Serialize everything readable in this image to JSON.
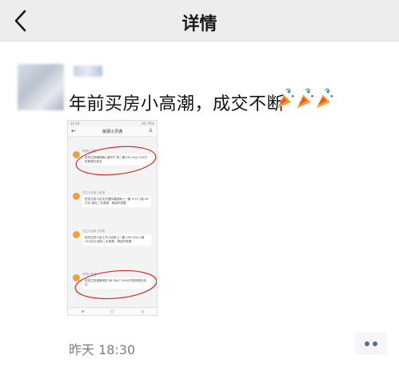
{
  "header": {
    "title": "详情",
    "back_icon": "chevron-left-icon"
  },
  "post": {
    "text": "年前买房小高潮，成交不断",
    "emoji": [
      "party-popper-icon",
      "party-popper-icon",
      "party-popper-icon"
    ],
    "timestamp": "昨天 18:30",
    "more_icon": "more-dots-icon"
  },
  "screenshot": {
    "status_time": "12:16",
    "status_right": "4G 76%",
    "nav_title": "房源小灵通",
    "messages": [
      {
        "tag": "房源小灵通",
        "text": "您关注的康翔商山新村广场二期135.49㎡ 135万的房源已成交"
      },
      {
        "tag": "关注小区新上房源",
        "text": "您关注的小区文丰国际嘉园新上一套 97㎡ 1室 98万元 南向二手房源，请及时查看。"
      },
      {
        "tag": "关注小区新上房源",
        "text": "您关注的小区江东小区新上一套 239.02㎡ 4室 135万元 南向二手房源，请及时查看。"
      },
      {
        "tag": "房源小灵通",
        "text": "您关注的香榭湾的 88.76㎡ 108.8万的房源已成交"
      }
    ],
    "bottom_icons": [
      "menu-icon",
      "home-icon",
      "back-icon"
    ]
  },
  "colors": {
    "header_bg": "#ededed",
    "accent_circle": "#d62e2e",
    "link_dots": "#5b6b92"
  }
}
